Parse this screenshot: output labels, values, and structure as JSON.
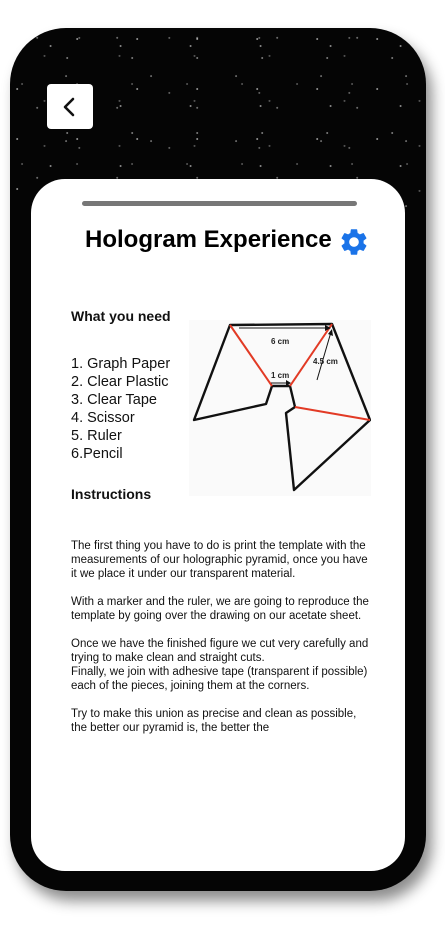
{
  "header": {
    "back_icon": "chevron-left-icon"
  },
  "sheet": {
    "title": "Hologram Experience",
    "settings_icon": "gear-icon",
    "accent_color": "#1a73e8"
  },
  "materials": {
    "heading": "What you need",
    "items": [
      "1. Graph Paper",
      "2. Clear Plastic",
      "3. Clear Tape",
      "4. Scissor",
      "5. Ruler",
      "6.Pencil"
    ]
  },
  "diagram": {
    "label_top": "6 cm",
    "label_side": "4.5 cm",
    "label_bottom": "1 cm"
  },
  "instructions": {
    "heading": "Instructions",
    "paragraphs": [
      "The first thing you have to do is print the template with the measurements of our holographic pyramid, once you have it we place it under our transparent material.",
      "With a marker and the ruler, we are going to reproduce the template by going over the drawing on our acetate sheet.",
      "Once we have the finished figure we cut very carefully and trying to make clean and straight cuts.",
      "Finally, we join with adhesive tape (transparent if possible) each of the pieces, joining them at the corners.",
      "Try to make this union as precise and clean as possible, the better our pyramid is, the better the"
    ]
  }
}
